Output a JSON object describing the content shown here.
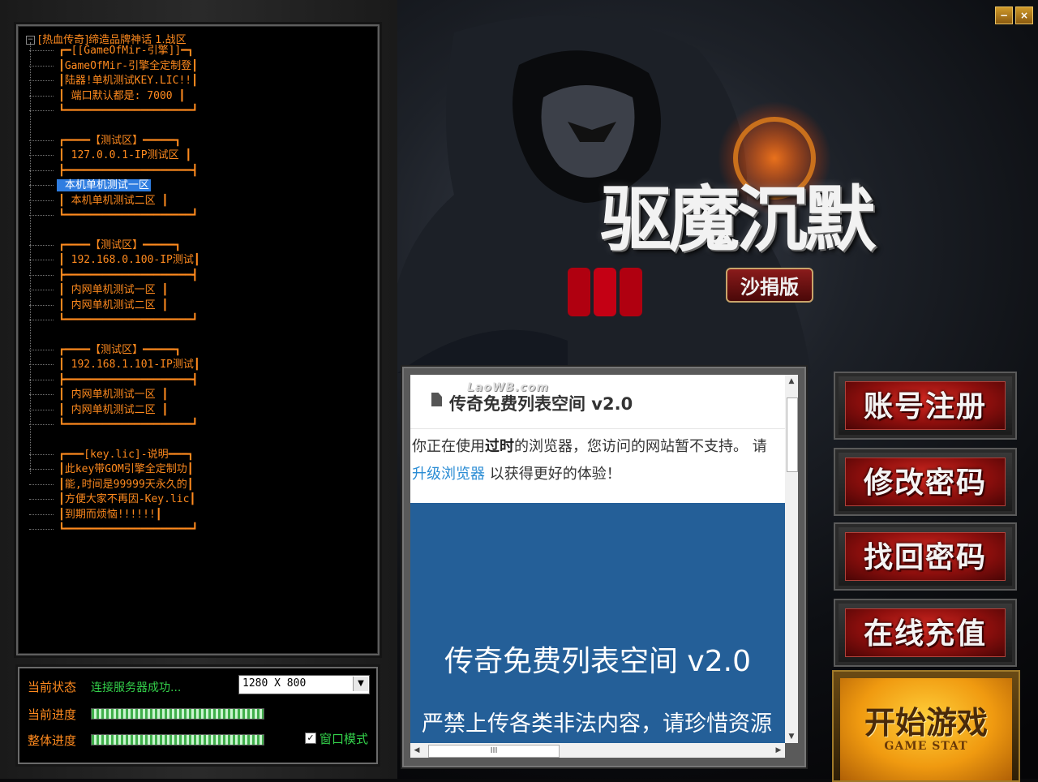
{
  "window": {
    "minimize_label": "−",
    "close_label": "×"
  },
  "server_tree": {
    "root_toggle": "−",
    "root_label": "[热血传奇]缔造品牌神话 1.战区",
    "items": [
      {
        "label": "┏━[[GameOfMir-引擎]]━┓"
      },
      {
        "label": "┃GameOfMir-引擎全定制登┃"
      },
      {
        "label": "┃陆器!单机测试KEY.LIC!!┃"
      },
      {
        "label": "┃ 端口默认都是: 7000 ┃"
      },
      {
        "label": "┗━━━━━━━━━━━━━━━━━━━━┛"
      },
      {
        "label": "┏━━━━【测试区】━━━━━┓"
      },
      {
        "label": "┃ 127.0.0.1-IP测试区 ┃"
      },
      {
        "label": "┣━━━━━━━━━━━━━━━━━━━━┫"
      },
      {
        "label": "  本机单机测试一区  ",
        "selected": true
      },
      {
        "label": "┃ 本机单机测试二区 ┃"
      },
      {
        "label": "┗━━━━━━━━━━━━━━━━━━━━┛"
      },
      {
        "label": "┏━━━━【测试区】━━━━━┓"
      },
      {
        "label": "┃ 192.168.0.100-IP测试┃"
      },
      {
        "label": "┣━━━━━━━━━━━━━━━━━━━━┫"
      },
      {
        "label": "┃ 内网单机测试一区 ┃"
      },
      {
        "label": "┃ 内网单机测试二区 ┃"
      },
      {
        "label": "┗━━━━━━━━━━━━━━━━━━━━┛"
      },
      {
        "label": "┏━━━━【测试区】━━━━━┓"
      },
      {
        "label": "┃ 192.168.1.101-IP测试┃"
      },
      {
        "label": "┣━━━━━━━━━━━━━━━━━━━━┫"
      },
      {
        "label": "┃ 内网单机测试一区 ┃"
      },
      {
        "label": "┃ 内网单机测试二区 ┃"
      },
      {
        "label": "┗━━━━━━━━━━━━━━━━━━━━┛"
      },
      {
        "label": "┏━━━[key.lic]-说明━━━┓"
      },
      {
        "label": "┃此key带GOM引擎全定制功┃"
      },
      {
        "label": "┃能,时间是99999天永久的┃"
      },
      {
        "label": "┃方便大家不再因-Key.lic┃"
      },
      {
        "label": "┃到期而烦恼!!!!!!┃"
      },
      {
        "label": "┗━━━━━━━━━━━━━━━━━━━━┛"
      }
    ]
  },
  "status": {
    "state_label": "当前状态",
    "state_value": "连接服务器成功...",
    "current_progress_label": "当前进度",
    "current_progress": 1.0,
    "total_progress_label": "整体进度",
    "total_progress": 1.0,
    "resolution_value": "1280 X 800",
    "window_mode_label": "窗口模式",
    "window_mode_checked": "✓"
  },
  "logo": {
    "title": "驱魔沉默",
    "subtitle": "沙捐版"
  },
  "browser": {
    "watermark": "LaoWB.com",
    "page_title": "传奇免费列表空间 v2.0",
    "notice_prefix": "你正在使用",
    "notice_bold": "过时",
    "notice_middle": "的浏览器，您访问的网站暂不支持。 请",
    "notice_link": "升级浏览器",
    "notice_suffix": " 以获得更好的体验！",
    "hero_title": "传奇免费列表空间 v2.0",
    "hero_sub": "严禁上传各类非法内容，请珍惜资源",
    "scroll_up": "▲",
    "scroll_down": "▼",
    "scroll_left": "◀",
    "scroll_right": "▶",
    "hscroll_grip": "III"
  },
  "menu": {
    "register": "账号注册",
    "change_password": "修改密码",
    "recover_password": "找回密码",
    "recharge": "在线充值",
    "start": "开始游戏",
    "start_sub": "GAME STAT"
  },
  "colors": {
    "tree_text": "#ff8a1e",
    "status_ok": "#33d04a",
    "selected_bg": "#2f7de0",
    "hero_bg": "#245f98"
  }
}
